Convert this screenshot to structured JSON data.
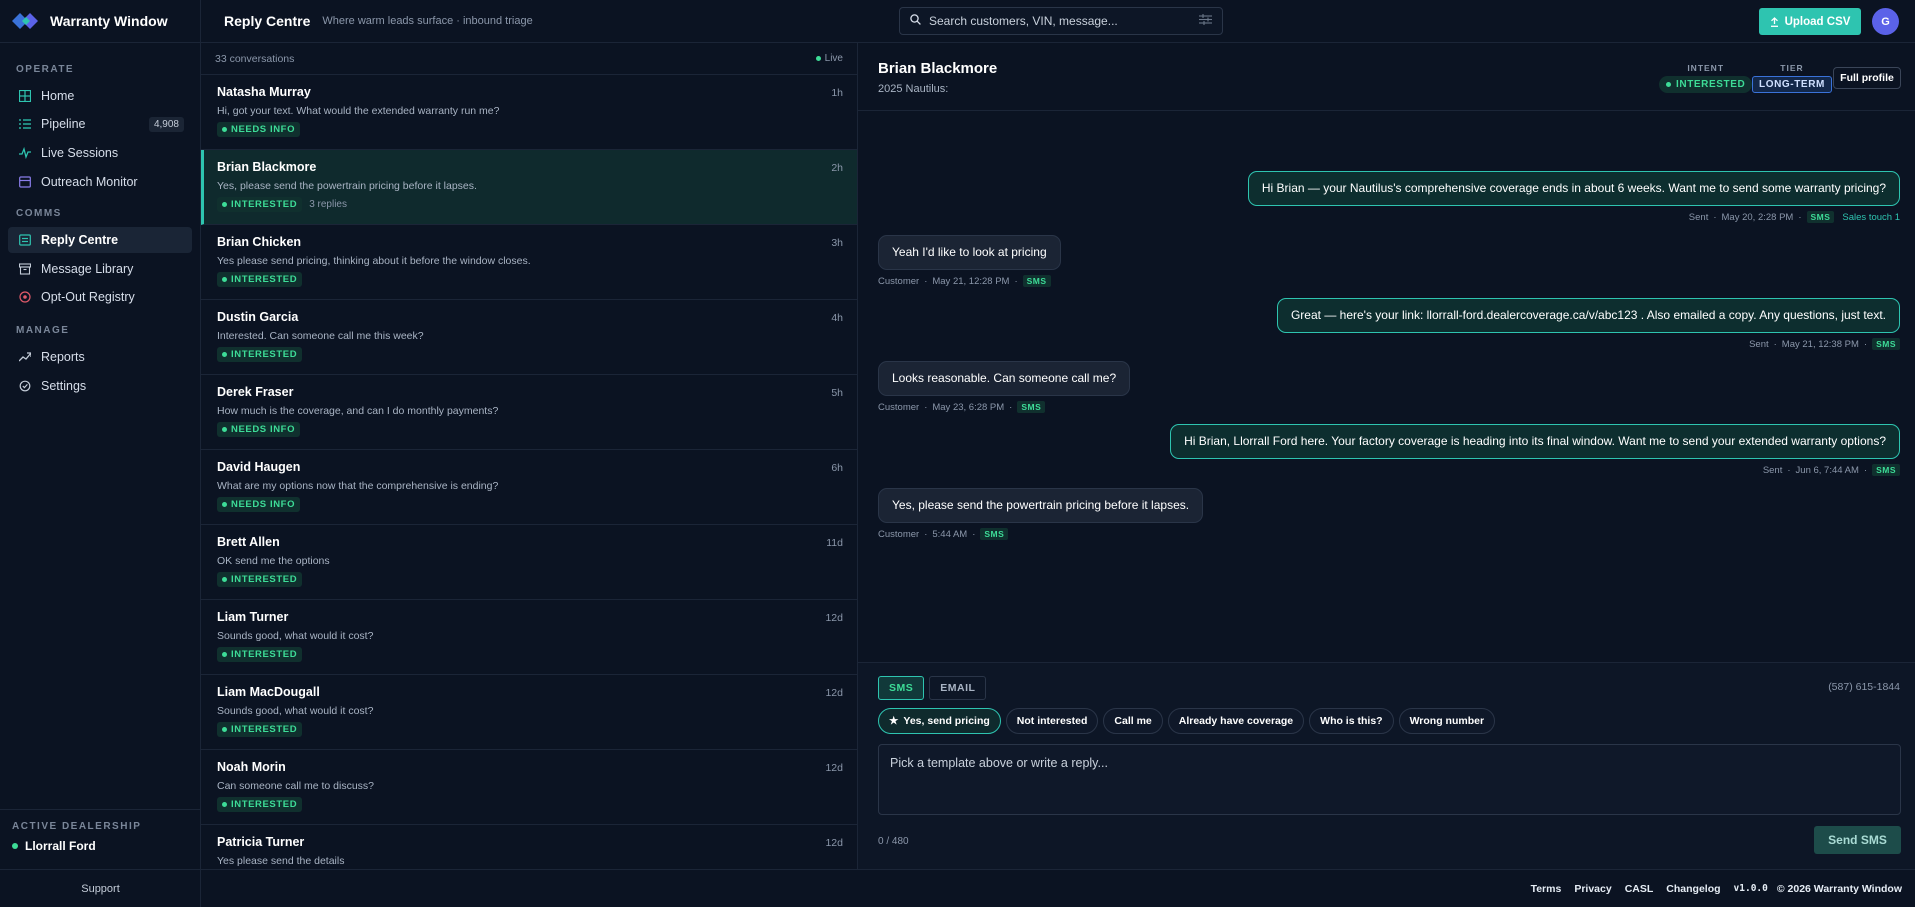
{
  "brand": {
    "name": "Warranty Window"
  },
  "sidebar": {
    "sections": [
      {
        "label": "OPERATE"
      },
      {
        "label": "COMMS"
      },
      {
        "label": "MANAGE"
      }
    ],
    "items": [
      {
        "label": "Home",
        "icon": "grid-icon"
      },
      {
        "label": "Pipeline",
        "icon": "list-icon",
        "badge": "4,908"
      },
      {
        "label": "Live Sessions",
        "icon": "activity-icon"
      },
      {
        "label": "Outreach Monitor",
        "icon": "monitor-icon"
      },
      {
        "label": "Reply Centre",
        "icon": "inbox-icon",
        "active": true
      },
      {
        "label": "Message Library",
        "icon": "archive-icon"
      },
      {
        "label": "Opt-Out Registry",
        "icon": "block-icon"
      },
      {
        "label": "Reports",
        "icon": "trend-icon"
      },
      {
        "label": "Settings",
        "icon": "gear-icon"
      }
    ],
    "dealer_label": "ACTIVE DEALERSHIP",
    "dealer_name": "Llorrall Ford",
    "support": "Support"
  },
  "header": {
    "title": "Reply Centre",
    "subtitle": "Where warm leads surface · inbound triage",
    "search_placeholder": "Search customers, VIN, message...",
    "upload_label": "Upload CSV",
    "avatar_initial": "G"
  },
  "conversations": {
    "count_label": "33 conversations",
    "live_label": "Live",
    "items": [
      {
        "name": "Natasha Murray",
        "time": "1h",
        "preview": "Hi, got your text. What would the extended warranty run me?",
        "status": "NEEDS INFO",
        "replies": ""
      },
      {
        "name": "Brian Blackmore",
        "time": "2h",
        "preview": "Yes, please send the powertrain pricing before it lapses.",
        "status": "INTERESTED",
        "replies": "3 replies"
      },
      {
        "name": "Brian Chicken",
        "time": "3h",
        "preview": "Yes please send pricing, thinking about it before the window closes.",
        "status": "INTERESTED",
        "replies": ""
      },
      {
        "name": "Dustin Garcia",
        "time": "4h",
        "preview": "Interested. Can someone call me this week?",
        "status": "INTERESTED",
        "replies": ""
      },
      {
        "name": "Derek Fraser",
        "time": "5h",
        "preview": "How much is the coverage, and can I do monthly payments?",
        "status": "NEEDS INFO",
        "replies": ""
      },
      {
        "name": "David Haugen",
        "time": "6h",
        "preview": "What are my options now that the comprehensive is ending?",
        "status": "NEEDS INFO",
        "replies": ""
      },
      {
        "name": "Brett Allen",
        "time": "11d",
        "preview": "OK send me the options",
        "status": "INTERESTED",
        "replies": ""
      },
      {
        "name": "Liam Turner",
        "time": "12d",
        "preview": "Sounds good, what would it cost?",
        "status": "INTERESTED",
        "replies": ""
      },
      {
        "name": "Liam MacDougall",
        "time": "12d",
        "preview": "Sounds good, what would it cost?",
        "status": "INTERESTED",
        "replies": ""
      },
      {
        "name": "Noah Morin",
        "time": "12d",
        "preview": "Can someone call me to discuss?",
        "status": "INTERESTED",
        "replies": ""
      },
      {
        "name": "Patricia Turner",
        "time": "12d",
        "preview": "Yes please send the details",
        "status": "",
        "replies": ""
      }
    ]
  },
  "detail": {
    "name": "Brian Blackmore",
    "vehicle": "2025 Nautilus:",
    "intent_label": "INTENT",
    "intent_value": "INTERESTED",
    "tier_label": "TIER",
    "tier_value": "LONG-TERM",
    "profile_button": "Full profile",
    "messages": [
      {
        "dir": "out",
        "text": "Hi Brian — your Nautilus's comprehensive coverage ends in about 6 weeks. Want me to send some warranty pricing?",
        "who": "Sent",
        "when": "May 20, 2:28 PM",
        "channel": "SMS",
        "touch": "Sales touch 1"
      },
      {
        "dir": "in",
        "text": "Yeah I'd like to look at pricing",
        "who": "Customer",
        "when": "May 21, 12:28 PM",
        "channel": "SMS",
        "touch": ""
      },
      {
        "dir": "out",
        "text": "Great — here's your link: llorrall-ford.dealercoverage.ca/v/abc123 . Also emailed a copy. Any questions, just text.",
        "who": "Sent",
        "when": "May 21, 12:38 PM",
        "channel": "SMS",
        "touch": ""
      },
      {
        "dir": "in",
        "text": "Looks reasonable. Can someone call me?",
        "who": "Customer",
        "when": "May 23, 6:28 PM",
        "channel": "SMS",
        "touch": ""
      },
      {
        "dir": "out",
        "text": "Hi Brian, Llorrall Ford here. Your factory coverage is heading into its final window. Want me to send your extended warranty options?",
        "who": "Sent",
        "when": "Jun 6, 7:44 AM",
        "channel": "SMS",
        "touch": ""
      },
      {
        "dir": "in",
        "text": "Yes, please send the powertrain pricing before it lapses.",
        "who": "Customer",
        "when": "5:44 AM",
        "channel": "SMS",
        "touch": ""
      }
    ]
  },
  "composer": {
    "tabs": [
      "SMS",
      "EMAIL"
    ],
    "phone": "(587) 615-1844",
    "chips": [
      "Yes, send pricing",
      "Not interested",
      "Call me",
      "Already have coverage",
      "Who is this?",
      "Wrong number"
    ],
    "placeholder": "Pick a template above or write a reply...",
    "counter": "0 / 480",
    "send_label": "Send SMS"
  },
  "footer": {
    "links": [
      "Terms",
      "Privacy",
      "CASL",
      "Changelog"
    ],
    "version": "v1.0.0",
    "copyright": "© 2026 Warranty Window"
  },
  "colors": {
    "accent": "#2ec4b0",
    "status_green": "#3ddc97",
    "tier_blue": "#3a72d9",
    "avatar": "#5b62e8"
  }
}
